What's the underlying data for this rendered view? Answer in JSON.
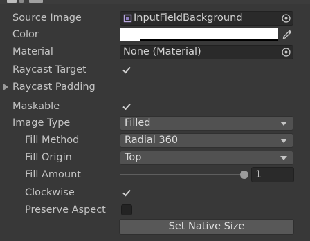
{
  "inspector": {
    "source_image": {
      "label": "Source Image",
      "value": "InputFieldBackground",
      "icon": "sprite-icon",
      "picker_icon": "object-picker-icon"
    },
    "color": {
      "label": "Color",
      "value": "#FFFFFF",
      "alpha": 1.0,
      "picker_icon": "eyedropper-icon"
    },
    "material": {
      "label": "Material",
      "value": "None (Material)",
      "picker_icon": "object-picker-icon"
    },
    "raycast_target": {
      "label": "Raycast Target",
      "checked": true
    },
    "raycast_padding": {
      "label": "Raycast Padding",
      "expanded": false
    },
    "maskable": {
      "label": "Maskable",
      "checked": true
    },
    "image_type": {
      "label": "Image Type",
      "value": "Filled"
    },
    "fill_method": {
      "label": "Fill Method",
      "value": "Radial 360"
    },
    "fill_origin": {
      "label": "Fill Origin",
      "value": "Top"
    },
    "fill_amount": {
      "label": "Fill Amount",
      "value": "1",
      "fraction": 1.0
    },
    "clockwise": {
      "label": "Clockwise",
      "checked": true
    },
    "preserve_aspect": {
      "label": "Preserve Aspect",
      "checked": false
    },
    "set_native_size": {
      "label": "Set Native Size"
    }
  },
  "colors": {
    "background": "#383838",
    "label_text": "#C4C4C4",
    "field_background": "#2A2A2A",
    "dropdown_background": "#515151",
    "checkmark": "#C8C8C8"
  }
}
